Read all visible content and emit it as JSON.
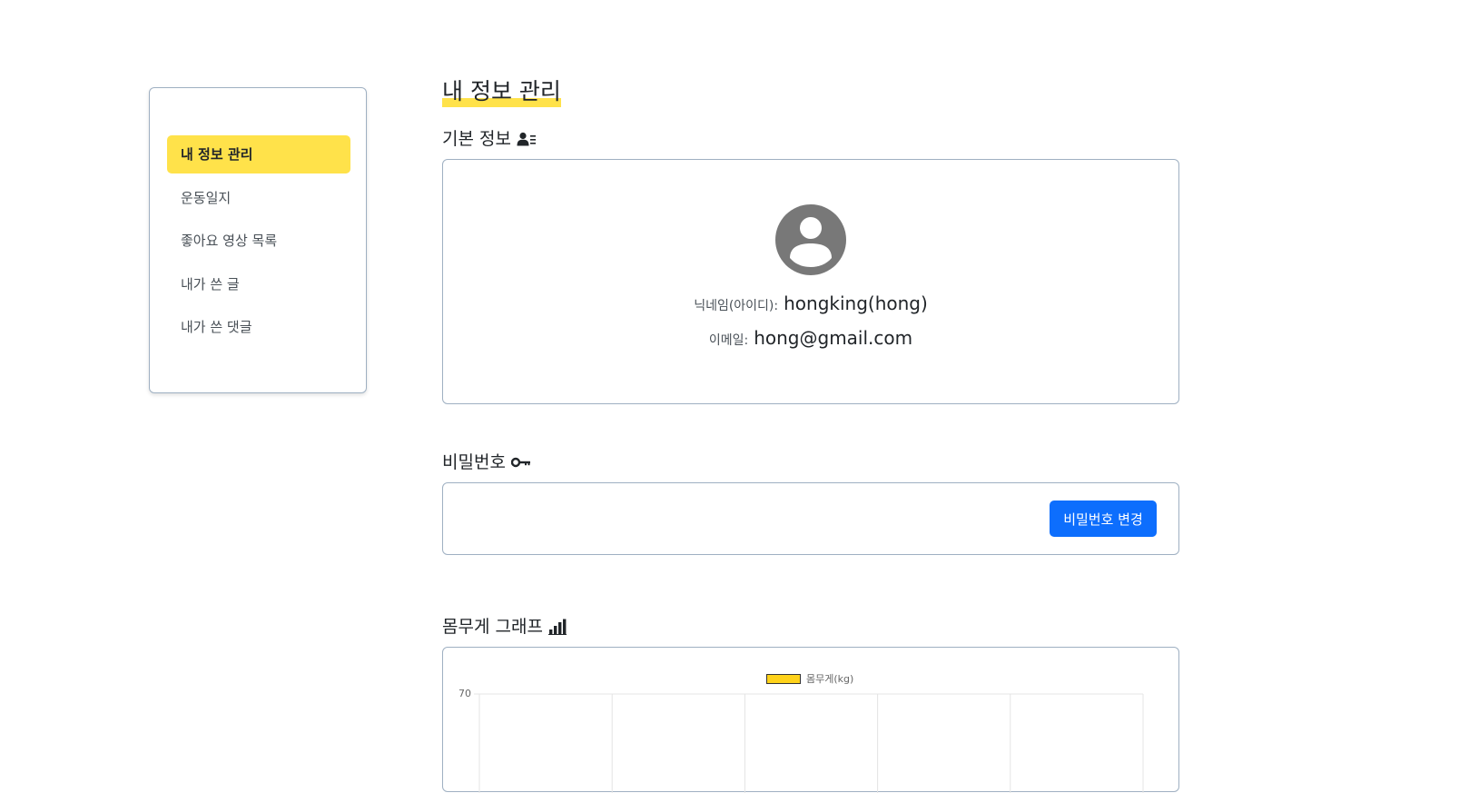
{
  "sidebar": {
    "items": [
      {
        "label": "내 정보 관리",
        "active": true
      },
      {
        "label": "운동일지",
        "active": false
      },
      {
        "label": "좋아요 영상 목록",
        "active": false
      },
      {
        "label": "내가 쓴 글",
        "active": false
      },
      {
        "label": "내가 쓴 댓글",
        "active": false
      }
    ]
  },
  "page": {
    "title": "내 정보 관리"
  },
  "basic_info": {
    "title": "기본 정보",
    "icon": "user-card-icon",
    "nickname_label": "닉네임(아이디):",
    "nickname_value": "hongking(hong)",
    "email_label": "이메일:",
    "email_value": "hong@gmail.com"
  },
  "password": {
    "title": "비밀번호",
    "icon": "key-icon",
    "change_button": "비밀번호 변경"
  },
  "weight_graph": {
    "title": "몸무게 그래프",
    "icon": "bar-chart-icon"
  },
  "colors": {
    "accent_yellow": "#ffe24a",
    "primary_blue": "#0d6efd",
    "bar_yellow": "#ffd21a"
  },
  "chart_data": {
    "type": "bar",
    "categories": [],
    "series": [
      {
        "name": "몸무게(kg)",
        "values": []
      }
    ],
    "y_ticks": [
      "70"
    ],
    "legend_position": "top"
  }
}
